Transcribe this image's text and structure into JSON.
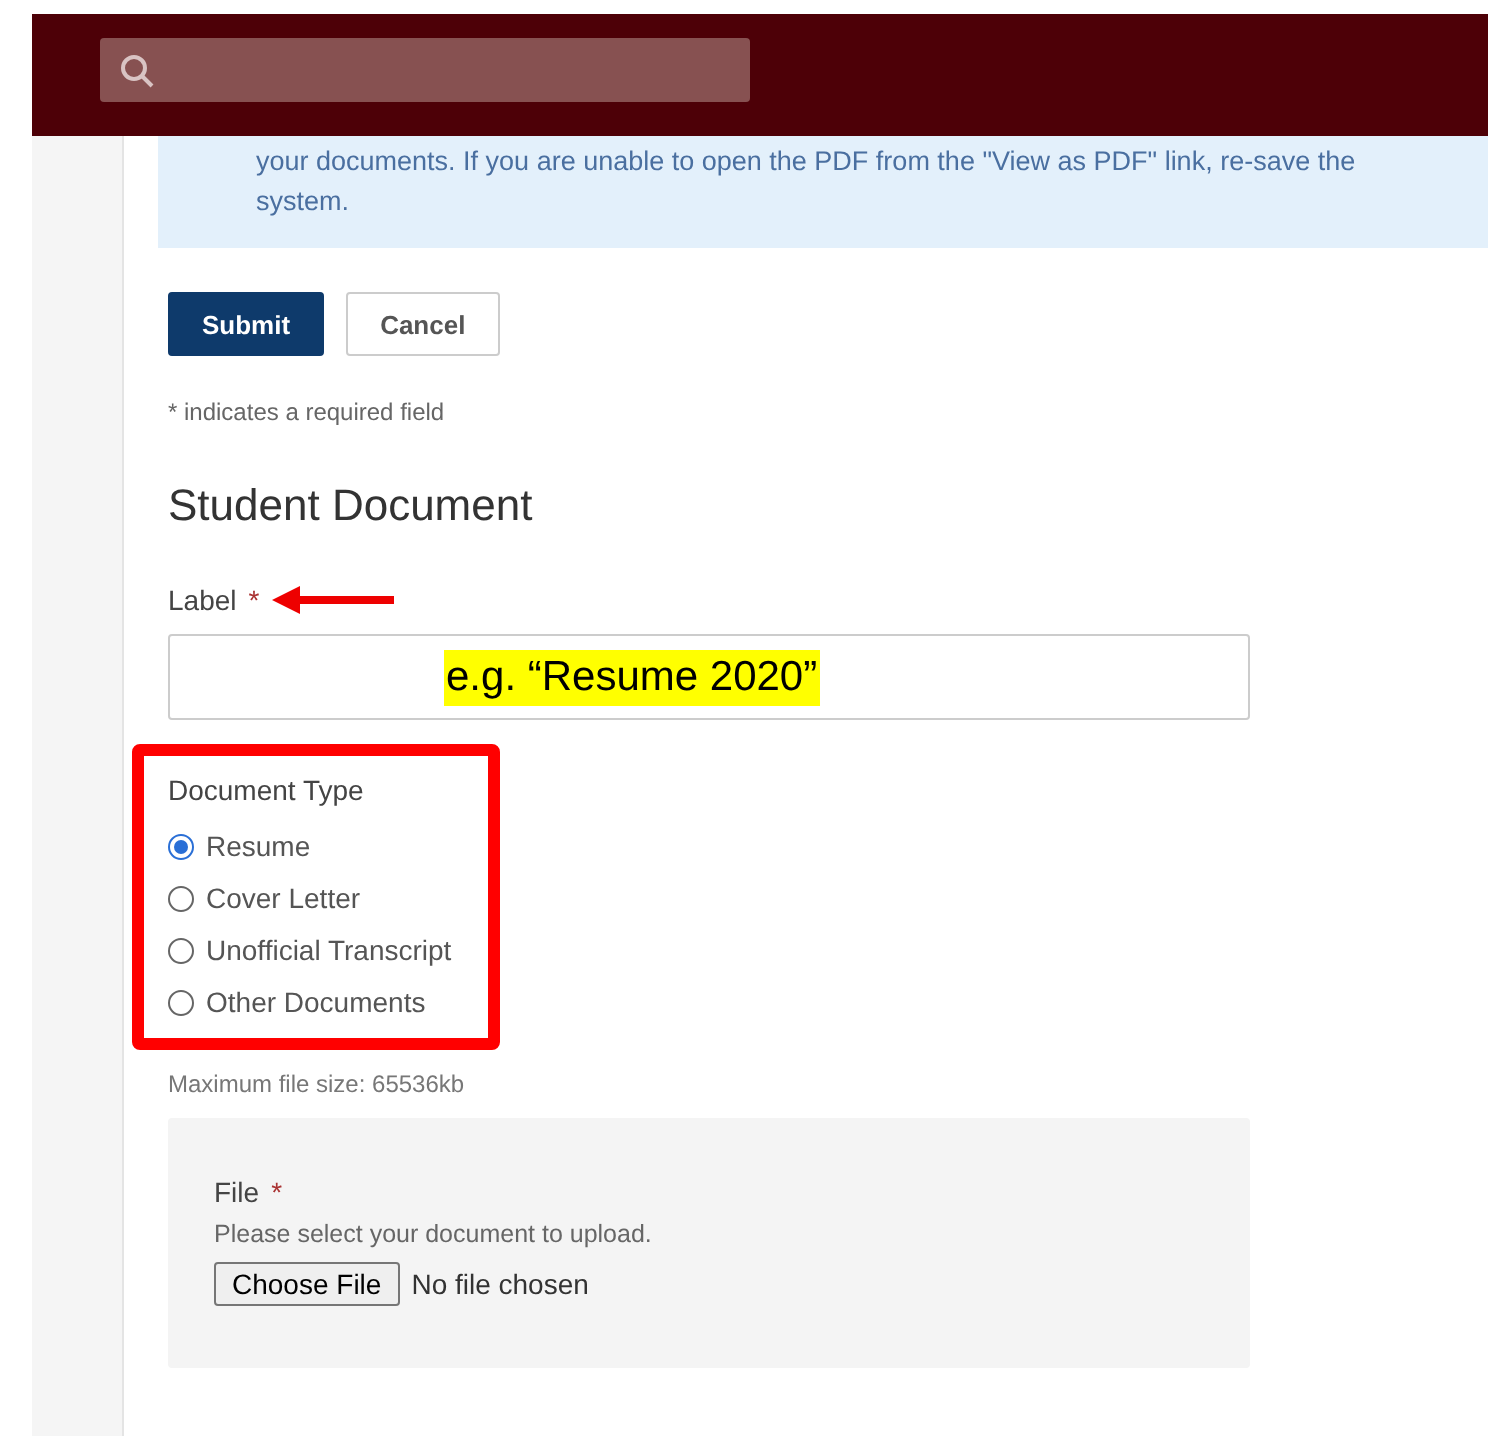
{
  "notice": {
    "lines": [
      "your documents. If you are unable to open the PDF from the \"View as PDF\" link, re-save the",
      "system."
    ]
  },
  "buttons": [
    {
      "label": "Submit",
      "kind": "primary"
    },
    {
      "label": "Cancel",
      "kind": "secondary"
    }
  ],
  "required_note": "* indicates a required field",
  "section_title": "Student Document",
  "label_field": {
    "label": "Label",
    "required": "*",
    "annotation": "e.g. “Resume 2020”",
    "arrow": true
  },
  "document_type": {
    "label": "Document Type",
    "highlighted": true,
    "options": [
      {
        "label": "Resume",
        "selected": true
      },
      {
        "label": "Cover Letter",
        "selected": false
      },
      {
        "label": "Unofficial Transcript",
        "selected": false
      },
      {
        "label": "Other Documents",
        "selected": false
      }
    ]
  },
  "max_size": "Maximum file size: 65536kb",
  "file": {
    "label": "File",
    "required": "*",
    "hint": "Please select your document to upload.",
    "button": "Choose File",
    "status": "No file chosen"
  }
}
